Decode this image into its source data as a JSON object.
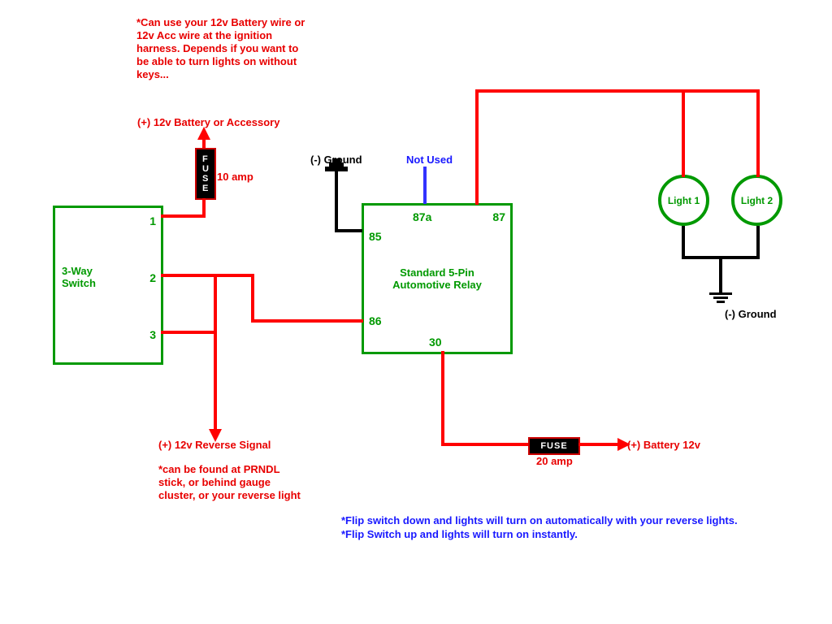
{
  "notes": {
    "top_note": "*Can use your 12v Battery wire or 12v Acc wire at the ignition harness. Depends if you want to be able to turn lights on without keys...",
    "battery_or_acc": "(+) 12v Battery or Accessory",
    "reverse_signal": "(+) 12v Reverse Signal",
    "reverse_note": "*can be found at PRNDL stick, or behind gauge cluster, or your reverse light",
    "bottom_note_1": "*Flip switch down and lights will turn on automatically with your reverse lights.",
    "bottom_note_2": "*Flip Switch up and lights will turn on instantly.",
    "not_used": "Not Used",
    "ground_top": "(-) Ground",
    "ground_lights": "(-) Ground",
    "battery12_right": "(+) Battery 12v"
  },
  "fuse": {
    "amp10": "10 amp",
    "amp20": "20 amp",
    "label_v": "FUSE",
    "label_h": "FUSE"
  },
  "switch": {
    "title": "3-Way\nSwitch",
    "pin1": "1",
    "pin2": "2",
    "pin3": "3"
  },
  "relay": {
    "title": "Standard 5-Pin\nAutomotive Relay",
    "pin85": "85",
    "pin86": "86",
    "pin87": "87",
    "pin87a": "87a",
    "pin30": "30"
  },
  "lights": {
    "l1": "Light 1",
    "l2": "Light 2"
  }
}
